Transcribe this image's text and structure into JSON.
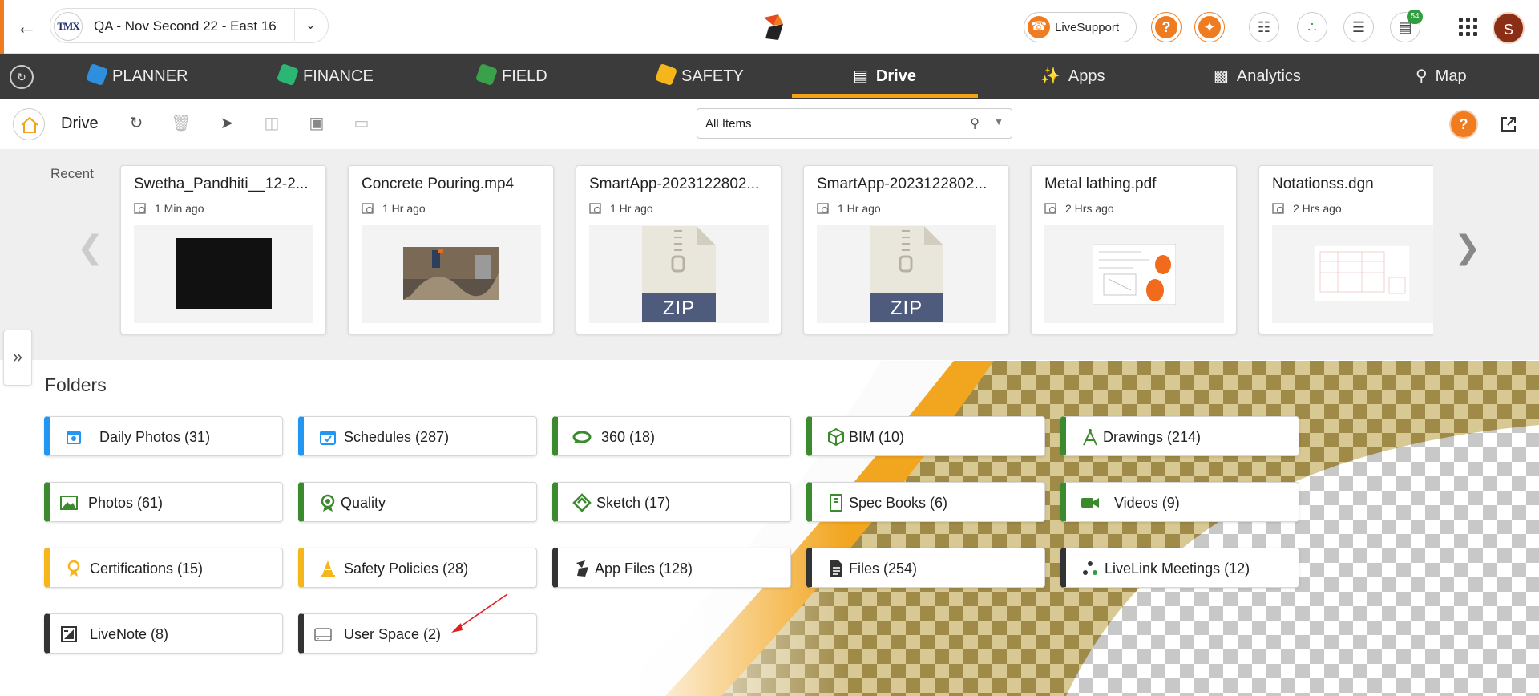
{
  "topbar": {
    "project_logo_text": "TMX",
    "project_name": "QA - Nov Second 22 - East 16",
    "live_support_label": "LiveSupport",
    "cart_badge": "54",
    "avatar_initial": "S"
  },
  "modules": [
    {
      "label": "PLANNER",
      "color": "#2d8fdd"
    },
    {
      "label": "FINANCE",
      "color": "#2bb673"
    },
    {
      "label": "FIELD",
      "color": "#3aa04a"
    },
    {
      "label": "SAFETY",
      "color": "#f5b61b"
    },
    {
      "label": "Drive",
      "active": true
    },
    {
      "label": "Apps"
    },
    {
      "label": "Analytics"
    },
    {
      "label": "Map"
    }
  ],
  "drive": {
    "title": "Drive",
    "filter_value": "All Items"
  },
  "recent": {
    "label": "Recent",
    "cards": [
      {
        "name": "Swetha_Pandhiti__12-2...",
        "time": "1 Min ago",
        "thumb": "black-image"
      },
      {
        "name": "Concrete Pouring.mp4",
        "time": "1 Hr ago",
        "thumb": "photo"
      },
      {
        "name": "SmartApp-2023122802...",
        "time": "1 Hr ago",
        "thumb": "zip",
        "zip_label": "ZIP"
      },
      {
        "name": "SmartApp-2023122802...",
        "time": "1 Hr ago",
        "thumb": "zip",
        "zip_label": "ZIP"
      },
      {
        "name": "Metal lathing.pdf",
        "time": "2 Hrs ago",
        "thumb": "pdf"
      },
      {
        "name": "Notationss.dgn",
        "time": "2 Hrs ago",
        "thumb": "drawing"
      }
    ]
  },
  "folders": {
    "title": "Folders",
    "items": [
      {
        "label": "Daily Photos (31)",
        "accent": "#2196f3",
        "icon": "calendar-photo-icon"
      },
      {
        "label": "Schedules (287)",
        "accent": "#2196f3",
        "icon": "calendar-icon"
      },
      {
        "label": "360 (18)",
        "accent": "#3c8a2e",
        "icon": "rotate-360-icon"
      },
      {
        "label": "BIM (10)",
        "accent": "#3c8a2e",
        "icon": "cube-icon"
      },
      {
        "label": "Drawings (214)",
        "accent": "#3c8a2e",
        "icon": "compass-icon"
      },
      {
        "label": "Photos (61)",
        "accent": "#3c8a2e",
        "icon": "image-icon"
      },
      {
        "label": "Quality",
        "accent": "#3c8a2e",
        "icon": "quality-badge-icon"
      },
      {
        "label": "Sketch (17)",
        "accent": "#3c8a2e",
        "icon": "sketch-icon"
      },
      {
        "label": "Spec Books (6)",
        "accent": "#3c8a2e",
        "icon": "book-icon"
      },
      {
        "label": "Videos (9)",
        "accent": "#3c8a2e",
        "icon": "video-camera-icon"
      },
      {
        "label": "Certifications (15)",
        "accent": "#f5b61b",
        "icon": "certificate-icon"
      },
      {
        "label": "Safety Policies (28)",
        "accent": "#f5b61b",
        "icon": "safety-cone-icon"
      },
      {
        "label": "App Files (128)",
        "accent": "#333333",
        "icon": "app-logo-icon"
      },
      {
        "label": "Files (254)",
        "accent": "#333333",
        "icon": "file-icon"
      },
      {
        "label": "LiveLink Meetings (12)",
        "accent": "#333333",
        "icon": "livelink-icon"
      },
      {
        "label": "LiveNote (8)",
        "accent": "#333333",
        "icon": "note-icon"
      },
      {
        "label": "User Space (2)",
        "accent": "#333333",
        "icon": "drive-icon"
      }
    ]
  }
}
